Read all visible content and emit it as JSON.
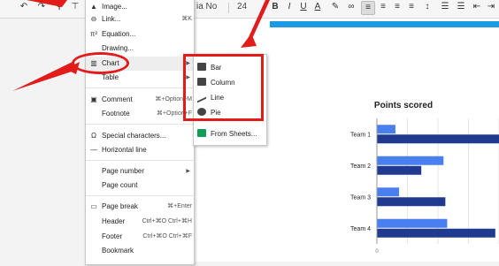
{
  "toolbar": {
    "font_name": "ia No",
    "font_size": "24",
    "bold": "B",
    "italic": "I",
    "underline": "U",
    "text_color": "A"
  },
  "menu": {
    "items": [
      {
        "icon": "▲",
        "label": "Image...",
        "shortcut": ""
      },
      {
        "icon": "⊖",
        "label": "Link...",
        "shortcut": "⌘K"
      },
      {
        "icon": "π²",
        "label": "Equation...",
        "shortcut": ""
      },
      {
        "icon": "",
        "label": "Drawing...",
        "shortcut": ""
      },
      {
        "icon": "▥",
        "label": "Chart",
        "shortcut": ""
      },
      {
        "icon": "",
        "label": "Table",
        "shortcut": ""
      },
      {
        "icon": "▣",
        "label": "Comment",
        "shortcut": "⌘+Option+M"
      },
      {
        "icon": "",
        "label": "Footnote",
        "shortcut": "⌘+Option+F"
      },
      {
        "icon": "Ω",
        "label": "Special characters...",
        "shortcut": ""
      },
      {
        "icon": "—",
        "label": "Horizontal line",
        "shortcut": ""
      },
      {
        "icon": "",
        "label": "Page number",
        "shortcut": ""
      },
      {
        "icon": "",
        "label": "Page count",
        "shortcut": ""
      },
      {
        "icon": "▭",
        "label": "Page break",
        "shortcut": "⌘+Enter"
      },
      {
        "icon": "",
        "label": "Header",
        "shortcut": "Ctrl+⌘O Ctrl+⌘H"
      },
      {
        "icon": "",
        "label": "Footer",
        "shortcut": "Ctrl+⌘O Ctrl+⌘F"
      },
      {
        "icon": "",
        "label": "Bookmark",
        "shortcut": ""
      }
    ]
  },
  "submenu": {
    "items": [
      {
        "label": "Bar"
      },
      {
        "label": "Column"
      },
      {
        "label": "Line"
      },
      {
        "label": "Pie"
      },
      {
        "label": "From Sheets..."
      }
    ]
  },
  "colors": {
    "annotation_red": "#e21b1b",
    "accent_blue": "#1a9be4",
    "series_light": "#4a7ff0",
    "series_dark": "#1f3a8e"
  },
  "chart_data": {
    "type": "bar",
    "title": "Points scored",
    "categories": [
      "Team 1",
      "Team 2",
      "Team 3",
      "Team 4"
    ],
    "series": [
      {
        "values": [
          10,
          36,
          12,
          38
        ]
      },
      {
        "values": [
          66,
          24,
          37,
          64
        ]
      }
    ],
    "x_tick_labels": [
      "0"
    ],
    "xlim": [
      0,
      66
    ]
  }
}
